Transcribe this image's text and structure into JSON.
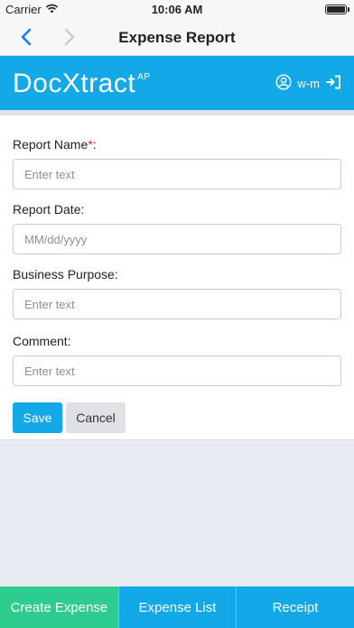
{
  "status_bar": {
    "carrier": "Carrier",
    "time": "10:06 AM",
    "battery_level": 1.0
  },
  "nav": {
    "title": "Expense Report"
  },
  "header": {
    "logo_text": "DocXtract",
    "logo_superscript": "AP",
    "username": "w-m",
    "brand_color": "#13a9e8"
  },
  "form": {
    "report_name": {
      "label": "Report Name",
      "required_mark": "*",
      "suffix": ":",
      "placeholder": "Enter text",
      "value": ""
    },
    "report_date": {
      "label": "Report Date:",
      "placeholder": "MM/dd/yyyy",
      "value": ""
    },
    "business_purpose": {
      "label": "Business Purpose:",
      "placeholder": "Enter text",
      "value": ""
    },
    "comment": {
      "label": "Comment:",
      "placeholder": "Enter text",
      "value": ""
    },
    "save_label": "Save",
    "cancel_label": "Cancel"
  },
  "tabs": [
    {
      "label": "Create Expense",
      "color": "#2ecc8f"
    },
    {
      "label": "Expense List",
      "color": "#13a9e8"
    },
    {
      "label": "Receipt",
      "color": "#13a9e8"
    }
  ],
  "icons": {
    "back": "chevron-left-icon",
    "forward": "chevron-right-icon",
    "user": "user-circle-icon",
    "logout": "sign-out-icon",
    "wifi": "wifi-icon",
    "battery": "battery-icon"
  }
}
